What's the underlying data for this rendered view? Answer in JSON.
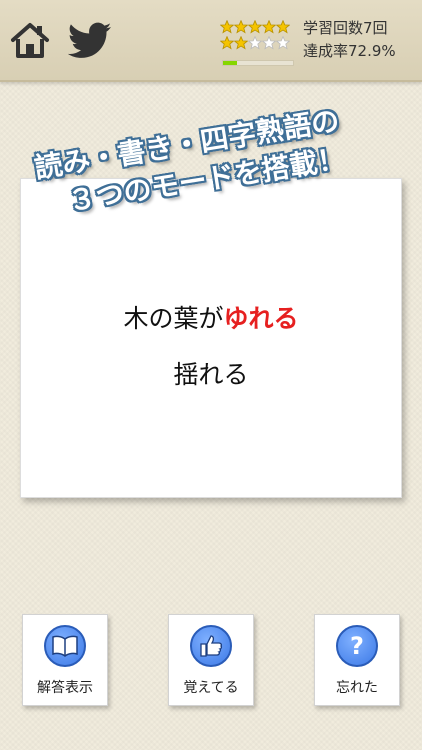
{
  "header": {
    "study_count": "学習回数7回",
    "achievement": "達成率72.9%",
    "stars_row1": {
      "filled": 5,
      "total": 5
    },
    "stars_row2": {
      "filled": 2,
      "total": 5
    },
    "progress": 0.2,
    "accent_color": "#86d600"
  },
  "banner": {
    "line1": "読み・書き・四字熟語の",
    "line2": "３つのモードを搭載！"
  },
  "card": {
    "question_prefix": "木の葉が",
    "question_highlight": "ゆれる",
    "answer": "揺れる"
  },
  "buttons": {
    "show_answer": "解答表示",
    "remembered": "覚えてる",
    "forgot": "忘れた"
  },
  "colors": {
    "highlight": "#e62020",
    "button_blue": "#3c79e6"
  },
  "icons": [
    "home-icon",
    "twitter-icon",
    "star-icon",
    "book-icon",
    "thumbs-up-icon",
    "question-icon"
  ]
}
